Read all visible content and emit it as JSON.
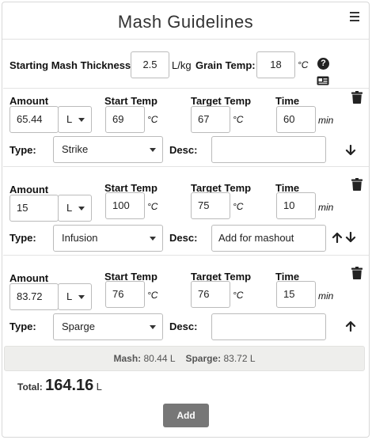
{
  "header": {
    "title": "Mash Guidelines",
    "menu_icon": "hamburger-icon"
  },
  "settings": {
    "thickness_label": "Starting Mash Thickness:",
    "thickness_value": "2.5",
    "thickness_unit": "L/kg",
    "grain_temp_label": "Grain Temp:",
    "grain_temp_value": "18",
    "grain_temp_unit": "°C",
    "help_icon": "question-circle-icon",
    "card_icon": "id-card-icon"
  },
  "labels": {
    "amount": "Amount",
    "start_temp": "Start Temp",
    "target_temp": "Target Temp",
    "time": "Time",
    "type": "Type:",
    "desc": "Desc:",
    "degc": "°C",
    "min": "min"
  },
  "steps": [
    {
      "amount": "65.44",
      "unit": "L",
      "start_temp": "69",
      "target_temp": "67",
      "time": "60",
      "type": "Strike",
      "desc": ""
    },
    {
      "amount": "15",
      "unit": "L",
      "start_temp": "100",
      "target_temp": "75",
      "time": "10",
      "type": "Infusion",
      "desc": "Add for mashout"
    },
    {
      "amount": "83.72",
      "unit": "L",
      "start_temp": "76",
      "target_temp": "76",
      "time": "15",
      "type": "Sparge",
      "desc": ""
    }
  ],
  "summary": {
    "mash_label": "Mash:",
    "mash_value": "80.44 L",
    "sparge_label": "Sparge:",
    "sparge_value": "83.72 L"
  },
  "total": {
    "label": "Total:",
    "value": "164.16",
    "unit": "L"
  },
  "add_button": "Add"
}
